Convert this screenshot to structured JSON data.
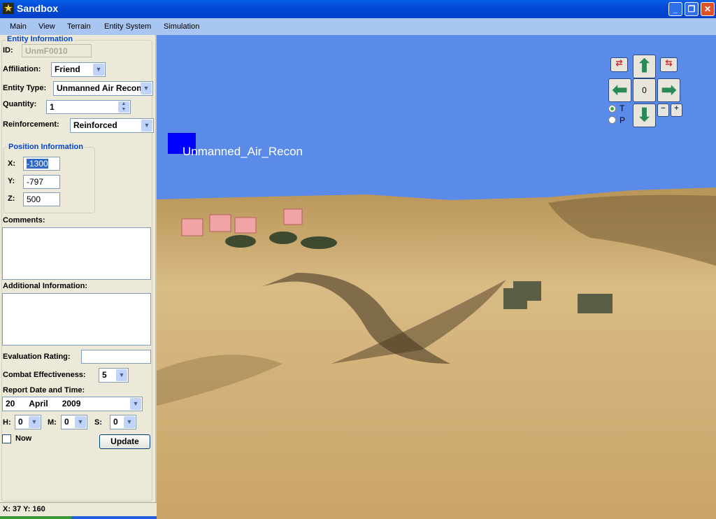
{
  "window": {
    "title": "Sandbox",
    "logo": "army-star-logo"
  },
  "menu": [
    "Main",
    "View",
    "Terrain",
    "Entity System",
    "Simulation"
  ],
  "entity_info": {
    "group_title": "Entity Information",
    "id_label": "ID:",
    "id_value": "UnmF0010",
    "affiliation_label": "Affiliation:",
    "affiliation_value": "Friend",
    "entity_type_label": "Entity Type:",
    "entity_type_value": "Unmanned Air Recon",
    "quantity_label": "Quantity:",
    "quantity_value": "1",
    "reinforcement_label": "Reinforcement:",
    "reinforcement_value": "Reinforced"
  },
  "position": {
    "group_title": "Position Information",
    "x_label": "X:",
    "x_value": "-1300",
    "y_label": "Y:",
    "y_value": "-797",
    "z_label": "Z:",
    "z_value": "500"
  },
  "comments_label": "Comments:",
  "additional_label": "Additional Information:",
  "evaluation_label": "Evaluation Rating:",
  "evaluation_value": "",
  "combat_label": "Combat Effectiveness:",
  "combat_value": "5",
  "report_label": "Report Date and Time:",
  "date": {
    "day": "20",
    "month": "April",
    "year": "2009"
  },
  "time": {
    "h_label": "H:",
    "h": "0",
    "m_label": "M:",
    "m": "0",
    "s_label": "S:",
    "s": "0"
  },
  "now_label": "Now",
  "now_checked": false,
  "update_label": "Update",
  "status": "X: 37 Y: 160",
  "viewport": {
    "entity_label": "Unmanned_Air_Recon",
    "entity_marker_color": "#0000ff",
    "sky_color": "#5b8be8",
    "terrain_color": "#d4b47c",
    "nav": {
      "center_value": "0",
      "mode_t": "T",
      "mode_p": "P",
      "selected_mode": "T"
    }
  }
}
